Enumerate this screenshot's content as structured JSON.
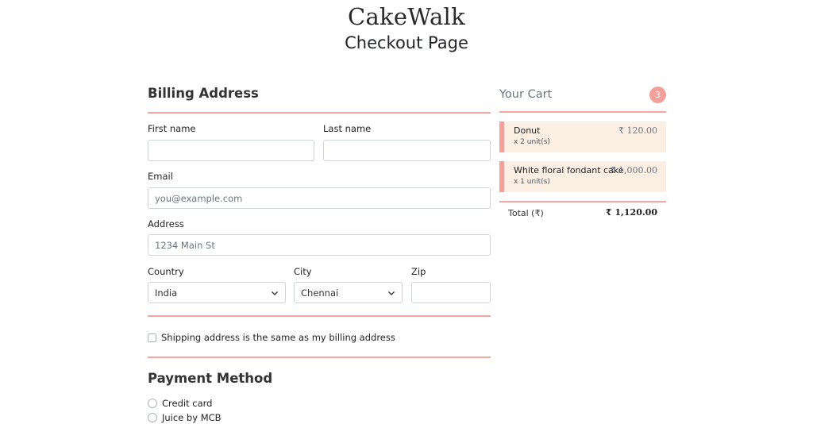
{
  "header": {
    "brand": "CakeWalk",
    "title": "Checkout Page"
  },
  "billing": {
    "heading": "Billing Address",
    "first_name": {
      "label": "First name",
      "value": ""
    },
    "last_name": {
      "label": "Last name",
      "value": ""
    },
    "email": {
      "label": "Email",
      "placeholder": "you@example.com"
    },
    "address": {
      "label": "Address",
      "placeholder": "1234 Main St"
    },
    "country": {
      "label": "Country",
      "selected": "India"
    },
    "city": {
      "label": "City",
      "selected": "Chennai"
    },
    "zip": {
      "label": "Zip",
      "value": ""
    },
    "same_address_label": "Shipping address is the same as my billing address"
  },
  "payment": {
    "heading": "Payment Method",
    "options": [
      "Credit card",
      "Juice by MCB"
    ]
  },
  "cart": {
    "title": "Your Cart",
    "count": "3",
    "items": [
      {
        "name": "Donut",
        "qty": "x 2 unit(s)",
        "price": "₹ 120.00"
      },
      {
        "name": "White floral fondant cake",
        "qty": "x 1 unit(s)",
        "price": "₹ 1,000.00"
      }
    ],
    "total_label": "Total (₹)",
    "total_value": "₹ 1,120.00"
  },
  "colors": {
    "accent": "#f4a09a",
    "item_bg": "#fbefe4",
    "muted": "#6c757d"
  }
}
